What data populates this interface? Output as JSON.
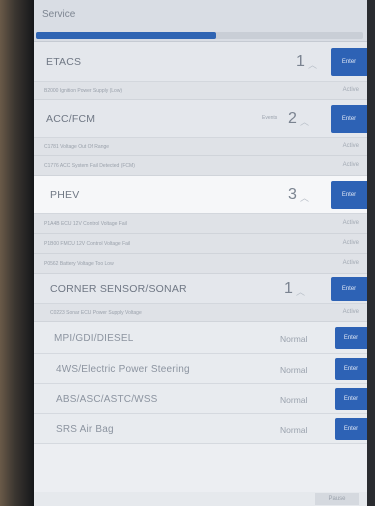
{
  "header": {
    "title": "Service",
    "progress": 0.55
  },
  "groups": [
    {
      "name": "ETACS",
      "count": "1",
      "button": "Enter",
      "dtcs": [
        {
          "text": "B2000 Ignition Power Supply (Low)",
          "state": "Active"
        }
      ]
    },
    {
      "name": "ACC/FCM",
      "meta": "Events",
      "count": "2",
      "button": "Enter",
      "dtcs": [
        {
          "text": "C1781 Voltage Out Of Range",
          "state": "Active"
        },
        {
          "text": "C1776 ACC System Fail Detected (FCM)",
          "state": "Active"
        }
      ]
    },
    {
      "name": "PHEV",
      "count": "3",
      "button": "Enter",
      "dtcs": [
        {
          "text": "P1A4B ECU 12V Control Voltage Fail",
          "state": "Active"
        },
        {
          "text": "P1B00 FMCU 12V Control Voltage Fail",
          "state": "Active"
        },
        {
          "text": "P0562 Battery Voltage Too Low",
          "state": "Active"
        }
      ]
    },
    {
      "name": "CORNER SENSOR/SONAR",
      "count": "1",
      "button": "Enter",
      "dtcs": [
        {
          "text": "C0223 Sonar ECU Power Supply Voltage",
          "state": "Active"
        }
      ]
    }
  ],
  "systems": [
    {
      "name": "MPI/GDI/DIESEL",
      "status": "Normal",
      "button": "Enter"
    },
    {
      "name": "4WS/Electric Power Steering",
      "status": "Normal",
      "button": "Enter"
    },
    {
      "name": "ABS/ASC/ASTC/WSS",
      "status": "Normal",
      "button": "Enter"
    },
    {
      "name": "SRS Air Bag",
      "status": "Normal",
      "button": "Enter"
    }
  ],
  "footer": {
    "button": "Pause"
  }
}
